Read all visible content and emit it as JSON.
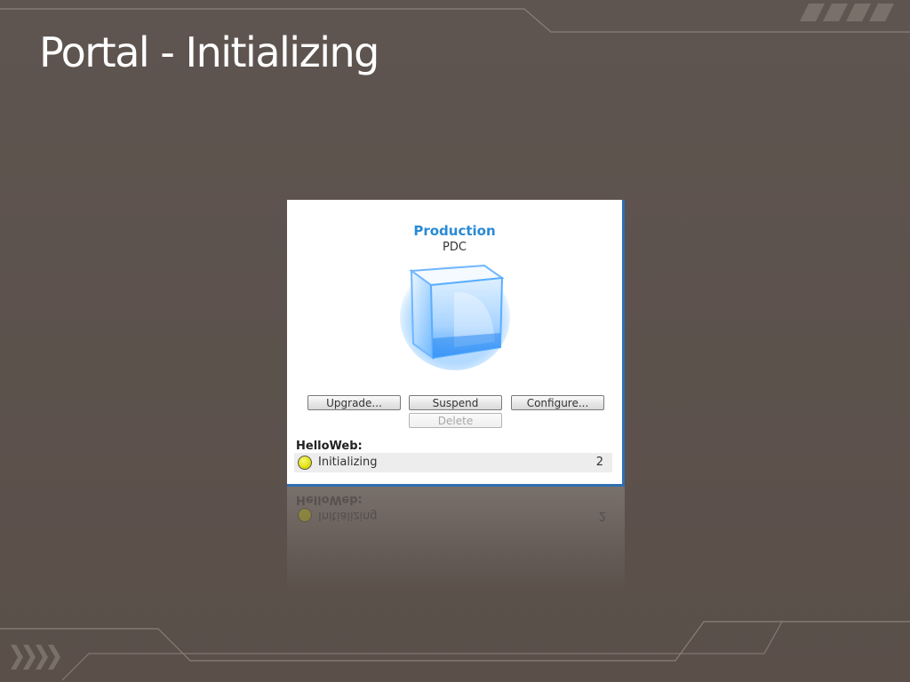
{
  "slide": {
    "title": "Portal - Initializing"
  },
  "deployment": {
    "name": "Production",
    "subtitle": "PDC"
  },
  "actions": {
    "upgrade_label": "Upgrade...",
    "suspend_label": "Suspend",
    "configure_label": "Configure...",
    "delete_label": "Delete"
  },
  "role": {
    "name": "HelloWeb:",
    "status": "Initializing",
    "instance_count": "2",
    "status_color": "#e3e312"
  },
  "icons": {
    "deployment": "hosted-service-cube-icon",
    "status": "status-yellow-dot-icon"
  },
  "colors": {
    "background": "#5d524c",
    "title": "#ffffff",
    "accent": "#2a8ad4",
    "panel_border": "#2d6fb0"
  }
}
